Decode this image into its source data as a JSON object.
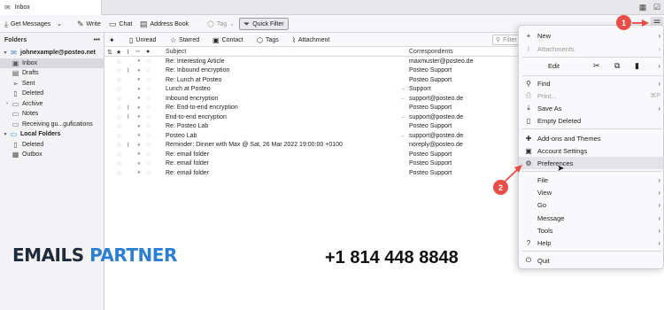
{
  "tab": {
    "title": "Inbox"
  },
  "toolbar": {
    "get_messages": "Get Messages",
    "write": "Write",
    "chat": "Chat",
    "address_book": "Address Book",
    "tag": "Tag",
    "quick_filter": "Quick Filter"
  },
  "folders": {
    "header": "Folders",
    "more": "•••",
    "items": [
      {
        "label": "johnexample@posteo.net",
        "icon": "account-icon",
        "bold": true
      },
      {
        "label": "Inbox",
        "icon": "inbox-icon",
        "selected": true
      },
      {
        "label": "Drafts",
        "icon": "drafts-icon"
      },
      {
        "label": "Sent",
        "icon": "sent-icon"
      },
      {
        "label": "Deleted",
        "icon": "trash-icon"
      },
      {
        "label": "Archive",
        "icon": "archive-icon"
      },
      {
        "label": "Notes",
        "icon": "folder-icon"
      },
      {
        "label": "Receiving gu...gufications",
        "icon": "folder-icon"
      },
      {
        "label": "Local Folders",
        "icon": "local-folders-icon",
        "bold": true
      },
      {
        "label": "Deleted",
        "icon": "trash-icon"
      },
      {
        "label": "Outbox",
        "icon": "outbox-icon"
      }
    ]
  },
  "quickfilter": {
    "unread": "Unread",
    "starred": "Starred",
    "contact": "Contact",
    "tags": "Tags",
    "attachment": "Attachment",
    "search_placeholder": "Filter these messages <⇧⌘K>"
  },
  "columns": {
    "subject": "Subject",
    "correspondents": "Correspondents"
  },
  "messages": [
    {
      "subject": "Re: Interesting Article",
      "correspondent": "maxmuster@posteo.de",
      "attach": false,
      "outgoing": false
    },
    {
      "subject": "Re: Inbound encryption",
      "correspondent": "Posteo Support",
      "attach": true,
      "outgoing": false
    },
    {
      "subject": "Re: Lunch at Posteo",
      "correspondent": "Posteo Support",
      "attach": false,
      "outgoing": false
    },
    {
      "subject": "Lunch at Posteo",
      "correspondent": "Support",
      "attach": false,
      "outgoing": true
    },
    {
      "subject": "Inbound encryption",
      "correspondent": "support@posteo.de",
      "attach": false,
      "outgoing": true
    },
    {
      "subject": "Re: End-to-end encryption",
      "correspondent": "Posteo Support",
      "attach": true,
      "outgoing": false
    },
    {
      "subject": "End-to-end encryption",
      "correspondent": "support@posteo.de",
      "attach": true,
      "outgoing": true
    },
    {
      "subject": "Re: Posteo Lab",
      "correspondent": "Posteo Support",
      "attach": false,
      "outgoing": false
    },
    {
      "subject": "Posteo Lab",
      "correspondent": "support@posteo.de",
      "attach": false,
      "outgoing": true
    },
    {
      "subject": "Reminder: Dinner with Max @ Sat, 26 Mar 2022 19:00:00 +0100",
      "correspondent": "noreply@posteo.de",
      "attach": true,
      "outgoing": false
    },
    {
      "subject": "Re: email folder",
      "correspondent": "Posteo Support",
      "attach": false,
      "outgoing": false
    },
    {
      "subject": "Re: email folder",
      "correspondent": "Posteo Support",
      "attach": false,
      "outgoing": false
    },
    {
      "subject": "Re: email folder",
      "correspondent": "Posteo Support",
      "attach": false,
      "outgoing": false
    }
  ],
  "menu": {
    "new": "New",
    "attachments": "Attachments",
    "edit": "Edit",
    "find": "Find",
    "print": "Print...",
    "print_shortcut": "⌘P",
    "save_as": "Save As",
    "empty_deleted": "Empty Deleted",
    "addons": "Add-ons and Themes",
    "account_settings": "Account Settings",
    "preferences": "Preferences",
    "file": "File",
    "view": "View",
    "go": "Go",
    "message": "Message",
    "tools": "Tools",
    "help": "Help",
    "quit": "Quit"
  },
  "annotations": {
    "badge1": "1",
    "badge2": "2",
    "accent": "#e84e47"
  },
  "overlay": {
    "logo_part1": "EMAILS",
    "logo_part2": "PARTNER",
    "phone": "+1 814 448 8848"
  }
}
